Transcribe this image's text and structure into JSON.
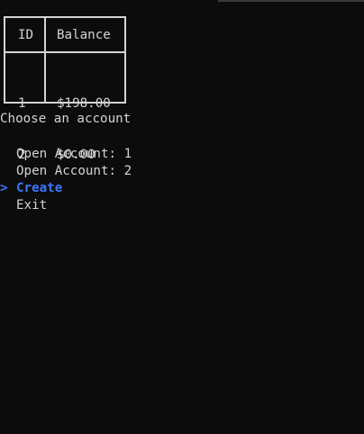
{
  "accounts_table": {
    "headers": {
      "id": "ID",
      "balance": "Balance"
    },
    "rows": [
      {
        "id": "1",
        "balance": "$198.00"
      },
      {
        "id": "2",
        "balance": "$0.00"
      }
    ]
  },
  "prompt": "Choose an account",
  "menu": {
    "cursor": ">",
    "selected_index": 2,
    "items": [
      {
        "label": "Open Account: 1"
      },
      {
        "label": "Open Account: 2"
      },
      {
        "label": "Create"
      },
      {
        "label": "Exit"
      }
    ]
  },
  "colors": {
    "background": "#0c0c0c",
    "foreground": "#d4d4d4",
    "selected": "#3b78ff"
  }
}
